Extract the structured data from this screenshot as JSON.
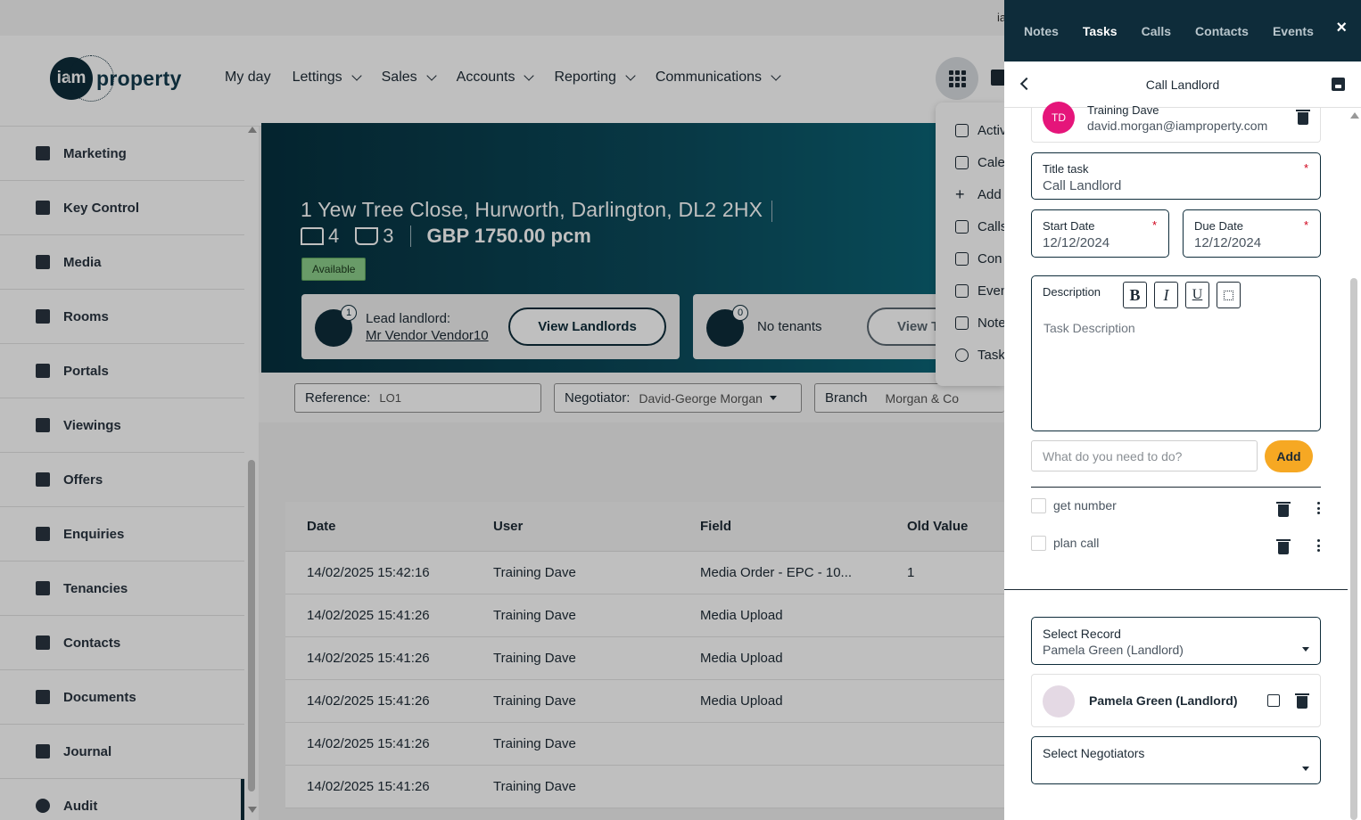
{
  "topbar": {
    "partial_text": "ia"
  },
  "logo": {
    "mark": "iam",
    "word": "property"
  },
  "nav": [
    {
      "label": "My day",
      "dropdown": false
    },
    {
      "label": "Lettings",
      "dropdown": true
    },
    {
      "label": "Sales",
      "dropdown": true
    },
    {
      "label": "Accounts",
      "dropdown": true
    },
    {
      "label": "Reporting",
      "dropdown": true
    },
    {
      "label": "Communications",
      "dropdown": true
    }
  ],
  "sidebar": {
    "items": [
      {
        "label": "Marketing",
        "icon": "bookmark-icon"
      },
      {
        "label": "Key Control",
        "icon": "key-icon"
      },
      {
        "label": "Media",
        "icon": "media-icon"
      },
      {
        "label": "Rooms",
        "icon": "sofa-icon"
      },
      {
        "label": "Portals",
        "icon": "portal-icon"
      },
      {
        "label": "Viewings",
        "icon": "eye-icon"
      },
      {
        "label": "Offers",
        "icon": "hand-icon"
      },
      {
        "label": "Enquiries",
        "icon": "message-icon"
      },
      {
        "label": "Tenancies",
        "icon": "people-icon"
      },
      {
        "label": "Contacts",
        "icon": "contact-card-icon"
      },
      {
        "label": "Documents",
        "icon": "folder-icon"
      },
      {
        "label": "Journal",
        "icon": "journal-icon"
      },
      {
        "label": "Audit",
        "icon": "check-circle-icon",
        "active": true
      }
    ]
  },
  "property": {
    "address": "1 Yew Tree Close, Hurworth, Darlington, DL2 2HX",
    "beds": "4",
    "baths": "3",
    "price": "GBP 1750.00 pcm",
    "status": "Available",
    "landlord_badge": "1",
    "landlord_label": "Lead landlord:",
    "landlord_name": "Mr Vendor Vendor10",
    "view_landlords": "View Landlords",
    "tenant_badge": "0",
    "tenants_label": "No tenants",
    "view_tenants": "View T"
  },
  "meta": {
    "reference_label": "Reference:",
    "reference_value": "LO1",
    "negotiator_label": "Negotiator:",
    "negotiator_value": "David-George Morgan",
    "branch_label": "Branch",
    "branch_value": "Morgan & Co"
  },
  "apps_menu": [
    "Activi",
    "Cale",
    "Add",
    "Calls",
    "Con",
    "Even",
    "Note",
    "Task"
  ],
  "audit_table": {
    "headers": [
      "Date",
      "User",
      "Field",
      "Old Value"
    ],
    "rows": [
      [
        "14/02/2025 15:42:16",
        "Training Dave",
        "Media Order - EPC - 10...",
        "1"
      ],
      [
        "14/02/2025 15:41:26",
        "Training Dave",
        "Media Upload",
        ""
      ],
      [
        "14/02/2025 15:41:26",
        "Training Dave",
        "Media Upload",
        ""
      ],
      [
        "14/02/2025 15:41:26",
        "Training Dave",
        "Media Upload",
        ""
      ],
      [
        "14/02/2025 15:41:26",
        "Training Dave",
        "",
        ""
      ],
      [
        "14/02/2025 15:41:26",
        "Training Dave",
        "",
        ""
      ]
    ]
  },
  "panel": {
    "tabs": [
      "Notes",
      "Tasks",
      "Calls",
      "Contacts",
      "Events"
    ],
    "active_tab": "Tasks",
    "close": "×",
    "title": "Call Landlord",
    "assignee": {
      "initials": "TD",
      "name": "Training Dave",
      "email": "david.morgan@iamproperty.com"
    },
    "title_task": {
      "label": "Title task",
      "value": "Call Landlord",
      "required": "*"
    },
    "start_date": {
      "label": "Start Date",
      "value": "12/12/2024",
      "required": "*"
    },
    "due_date": {
      "label": "Due Date",
      "value": "12/12/2024",
      "required": "*"
    },
    "description": {
      "label": "Description",
      "placeholder": "Task Description",
      "bold": "B",
      "italic": "I",
      "underline": "U"
    },
    "todo": {
      "placeholder": "What do you need to do?",
      "add_label": "Add",
      "items": [
        "get number",
        "plan call"
      ]
    },
    "select_record": {
      "label": "Select Record",
      "value": "Pamela Green (Landlord)"
    },
    "linked_record": "Pamela Green (Landlord)",
    "select_negotiators": {
      "label": "Select Negotiators",
      "value": ""
    }
  },
  "colors": {
    "brand_dark": "#0e2c3a",
    "accent": "#f6a823",
    "available": "#8ccf8b",
    "avatar": "#e5157a",
    "required": "#d0021b"
  }
}
